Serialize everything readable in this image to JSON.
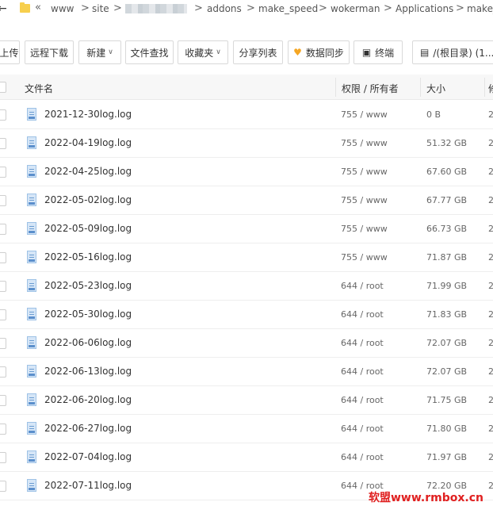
{
  "pathbar": {
    "back_glyph": "←",
    "up_glyph": "«",
    "sep": ">",
    "crumbs": [
      "www",
      "site",
      "addons",
      "make_speed",
      "wokerman",
      "Applications",
      "make_"
    ]
  },
  "toolbar": {
    "upload": "上传",
    "remote_download": "远程下载",
    "new": "新建",
    "find": "文件查找",
    "favorites": "收藏夹",
    "share_list": "分享列表",
    "sync": "数据同步",
    "terminal": "终端",
    "disk": "/(根目录) (1...",
    "caret": "∨"
  },
  "table": {
    "headers": {
      "name": "文件名",
      "perm": "权限 / 所有者",
      "size": "大小",
      "more": "修"
    },
    "rows": [
      {
        "name": "2021-12-30log.log",
        "perm": "755 / www",
        "size": "0 B",
        "more": "2"
      },
      {
        "name": "2022-04-19log.log",
        "perm": "755 / www",
        "size": "51.32 GB",
        "more": "2"
      },
      {
        "name": "2022-04-25log.log",
        "perm": "755 / www",
        "size": "67.60 GB",
        "more": "2"
      },
      {
        "name": "2022-05-02log.log",
        "perm": "755 / www",
        "size": "67.77 GB",
        "more": "2"
      },
      {
        "name": "2022-05-09log.log",
        "perm": "755 / www",
        "size": "66.73 GB",
        "more": "2"
      },
      {
        "name": "2022-05-16log.log",
        "perm": "755 / www",
        "size": "71.87 GB",
        "more": "2"
      },
      {
        "name": "2022-05-23log.log",
        "perm": "644 / root",
        "size": "71.99 GB",
        "more": "2"
      },
      {
        "name": "2022-05-30log.log",
        "perm": "644 / root",
        "size": "71.83 GB",
        "more": "2"
      },
      {
        "name": "2022-06-06log.log",
        "perm": "644 / root",
        "size": "72.07 GB",
        "more": "2"
      },
      {
        "name": "2022-06-13log.log",
        "perm": "644 / root",
        "size": "72.07 GB",
        "more": "2"
      },
      {
        "name": "2022-06-20log.log",
        "perm": "644 / root",
        "size": "71.75 GB",
        "more": "2"
      },
      {
        "name": "2022-06-27log.log",
        "perm": "644 / root",
        "size": "71.80 GB",
        "more": "2"
      },
      {
        "name": "2022-07-04log.log",
        "perm": "644 / root",
        "size": "71.97 GB",
        "more": "2"
      },
      {
        "name": "2022-07-11log.log",
        "perm": "644 / root",
        "size": "72.20 GB",
        "more": "2"
      }
    ]
  },
  "watermark": "软盟www.rmbox.cn",
  "colors": {
    "folder": "#f7cf4d",
    "sync_icon": "#f5a623",
    "watermark": "#e02020"
  }
}
